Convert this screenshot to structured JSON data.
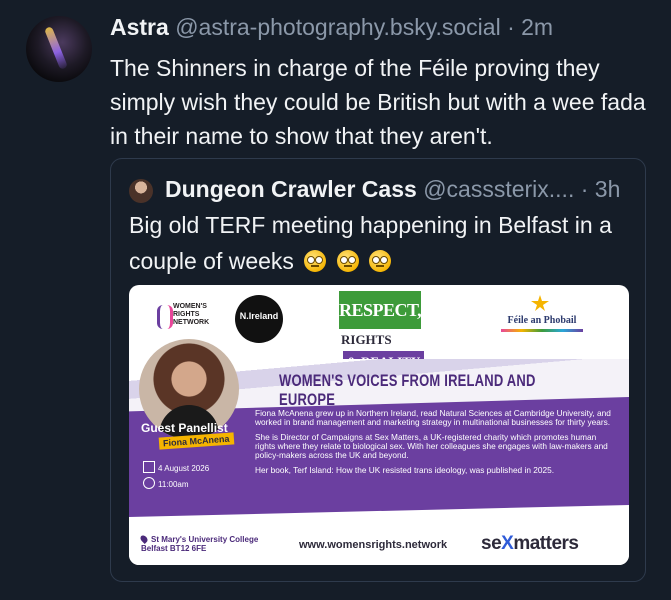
{
  "post": {
    "author": "Astra",
    "handle": "@astra-photography.bsky.social",
    "separator": "·",
    "time": "2m",
    "text": "The Shinners in charge of the Féile proving they simply wish they could be British but with a wee fada in their name to show that they aren't."
  },
  "quote": {
    "author": "Dungeon Crawler Cass",
    "handle": "@casssterix....",
    "separator": "·",
    "time": "3h",
    "text": "Big old TERF meeting happening in Belfast in a couple of weeks",
    "emoji": "eye-roll-emoji"
  },
  "flyer": {
    "wrn_logo": "WOMEN'S\nRIGHTS\nNETWORK",
    "ni_logo": "N.Ireland",
    "respect": "RESPECT,",
    "rights": "RIGHTS",
    "reality": "& REALITY",
    "feile": "Féile an Phobail",
    "banner_title": "WOMEN'S VOICES FROM IRELAND AND EUROPE",
    "guest_label": "Guest Panellist",
    "guest_name": "Fiona McAnena",
    "date": "4 August 2026",
    "time": "11:00am",
    "bio_1": "Fiona McAnena grew up in Northern Ireland, read Natural Sciences at Cambridge University, and worked in brand management and marketing strategy in multinational businesses for thirty years.",
    "bio_2": "She is Director of Campaigns at Sex Matters, a UK-registered charity which promotes human rights where they relate to biological sex. With her colleagues she engages with law-makers and policy-makers across the UK and beyond.",
    "bio_3": "Her book, Terf Island: How the UK resisted trans ideology, was published in 2025.",
    "venue": "St Mary's University College\nBelfast BT12 6FE",
    "website": "www.womensrights.network",
    "sponsor_a": "se",
    "sponsor_x": "X",
    "sponsor_b": "matters",
    "colors": {
      "purple": "#6b3fa0",
      "green": "#3d9b3a",
      "accent_yellow": "#f5b400"
    }
  },
  "theme": {
    "background": "#151d28",
    "muted_text": "#8b98a9",
    "card_border": "#2e3a4c"
  }
}
